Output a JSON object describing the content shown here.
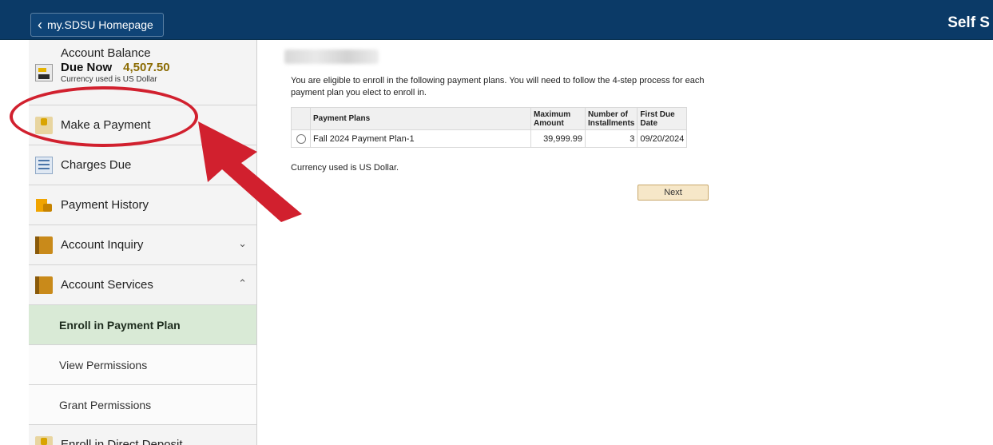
{
  "banner": {
    "home_label": "my.SDSU Homepage",
    "title": "Self S"
  },
  "sidebar": {
    "balance": {
      "title": "Account Balance",
      "due_label": "Due Now",
      "due_amount": "4,507.50",
      "currency_note": "Currency used is US Dollar"
    },
    "items": [
      {
        "label": "Make a Payment"
      },
      {
        "label": "Charges Due"
      },
      {
        "label": "Payment History"
      },
      {
        "label": "Account Inquiry"
      },
      {
        "label": "Account Services"
      },
      {
        "label": "Enroll in Payment Plan"
      },
      {
        "label": "View Permissions"
      },
      {
        "label": "Grant Permissions"
      },
      {
        "label": "Enroll in Direct Deposit"
      }
    ]
  },
  "main": {
    "intro": "You are eligible to enroll in the following payment plans. You will need to follow the 4-step process for each payment plan you elect to enroll in.",
    "table": {
      "headers": {
        "plan": "Payment Plans",
        "max_amount": "Maximum Amount",
        "installments": "Number of Installments",
        "first_due": "First Due Date"
      },
      "rows": [
        {
          "plan": "Fall 2024 Payment Plan-1",
          "max_amount": "39,999.99",
          "installments": "3",
          "first_due": "09/20/2024"
        }
      ]
    },
    "currency_note": "Currency used is US Dollar.",
    "next_label": "Next"
  },
  "colors": {
    "banner": "#0b3a67",
    "active_item": "#d9ead6",
    "annotation": "#d1202e",
    "next_button": "#f6e7c8"
  }
}
